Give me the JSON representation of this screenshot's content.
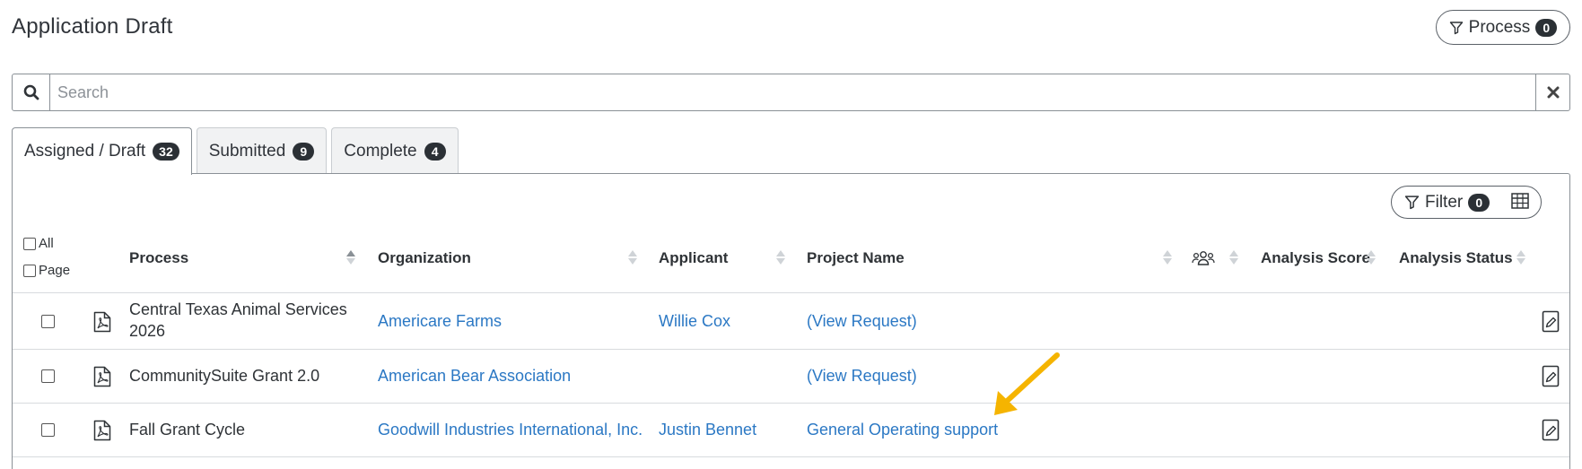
{
  "page": {
    "title": "Application Draft"
  },
  "process_filter": {
    "label": "Process",
    "count": "0"
  },
  "search": {
    "placeholder": "Search"
  },
  "tabs": [
    {
      "label": "Assigned / Draft",
      "count": "32",
      "active": true
    },
    {
      "label": "Submitted",
      "count": "9",
      "active": false
    },
    {
      "label": "Complete",
      "count": "4",
      "active": false
    }
  ],
  "table_filter": {
    "label": "Filter",
    "count": "0"
  },
  "select": {
    "all_label": "All",
    "page_label": "Page"
  },
  "columns": {
    "process": "Process",
    "organization": "Organization",
    "applicant": "Applicant",
    "project_name": "Project Name",
    "team_icon": "people-group-icon",
    "analysis_score": "Analysis Score",
    "analysis_status": "Analysis Status"
  },
  "rows": [
    {
      "process_line1": "Central Texas Animal Services",
      "process_line2": "2026",
      "organization": "Americare Farms",
      "applicant": "Willie Cox",
      "project_name": "(View Request)"
    },
    {
      "process_line1": "CommunitySuite Grant 2.0",
      "process_line2": "",
      "organization": "American Bear Association",
      "applicant": "",
      "project_name": "(View Request)"
    },
    {
      "process_line1": "Fall Grant Cycle",
      "process_line2": "",
      "organization": "Goodwill Industries International, Inc.",
      "applicant": "Justin Bennet",
      "project_name": "General Operating support"
    }
  ],
  "colors": {
    "link": "#2b78c4",
    "annotation_arrow": "#f5b400",
    "badge_bg": "#2b3035"
  }
}
